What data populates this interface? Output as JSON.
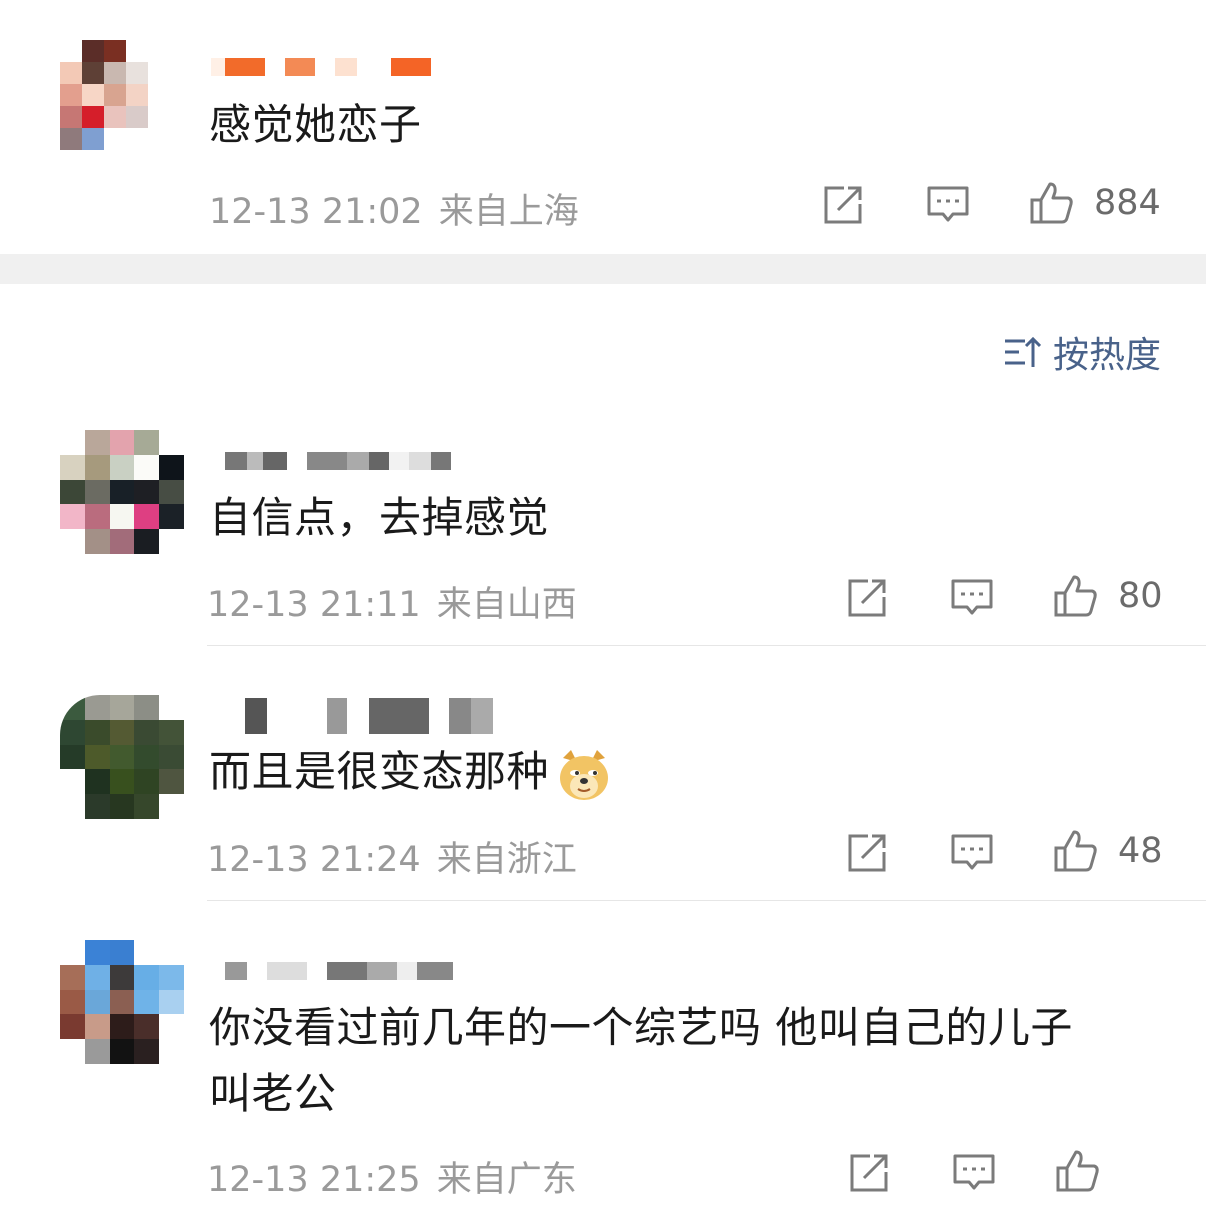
{
  "comments": [
    {
      "text": "感觉她恋子",
      "time": "12-13 21:02",
      "location": "来自上海",
      "likes": "884",
      "username_blurred": true
    },
    {
      "text": "自信点，去掉感觉",
      "time": "12-13 21:11",
      "location": "来自山西",
      "likes": "80",
      "username_blurred": true
    },
    {
      "text": "而且是很变态那种",
      "emoji": "doge-emoji",
      "time": "12-13 21:24",
      "location": "来自浙江",
      "likes": "48",
      "username_blurred": true
    },
    {
      "text_line1": "你没看过前几年的一个综艺吗 他叫自己的儿子",
      "text_line2": "叫老公",
      "time": "12-13 21:25",
      "location": "来自广东",
      "username_blurred": true
    }
  ],
  "sort": {
    "icon": "sort-icon",
    "label": "按热度"
  },
  "icons": [
    "share-icon",
    "comment-icon",
    "like-icon",
    "sort-icon",
    "doge-emoji"
  ],
  "colors": {
    "text": "#1a1a1a",
    "meta": "#9a9a9a",
    "sort_accent": "#49628a",
    "band": "#f0f0f0"
  }
}
